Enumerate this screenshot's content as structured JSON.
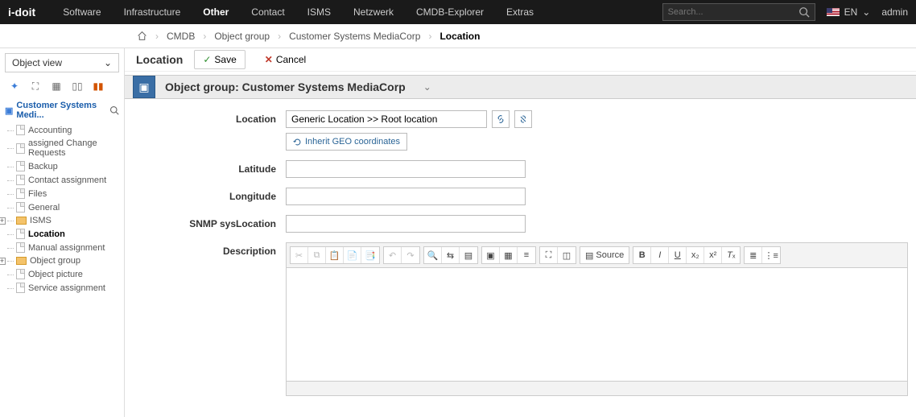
{
  "topnav": {
    "logo": "i-doit",
    "items": [
      "Software",
      "Infrastructure",
      "Other",
      "Contact",
      "ISMS",
      "Netzwerk",
      "CMDB-Explorer",
      "Extras"
    ],
    "active_index": 2,
    "search_placeholder": "Search...",
    "language": "EN",
    "username": "admin"
  },
  "breadcrumb": {
    "items": [
      "CMDB",
      "Object group",
      "Customer Systems MediaCorp",
      "Location"
    ],
    "active_index": 3
  },
  "sidebar": {
    "selector_label": "Object view",
    "root_label": "Customer Systems Medi...",
    "items": [
      {
        "label": "Accounting",
        "type": "file"
      },
      {
        "label": "assigned Change Requests",
        "type": "file"
      },
      {
        "label": "Backup",
        "type": "file"
      },
      {
        "label": "Contact assignment",
        "type": "file"
      },
      {
        "label": "Files",
        "type": "file"
      },
      {
        "label": "General",
        "type": "file"
      },
      {
        "label": "ISMS",
        "type": "folder",
        "expandable": true
      },
      {
        "label": "Location",
        "type": "file",
        "selected": true
      },
      {
        "label": "Manual assignment",
        "type": "file"
      },
      {
        "label": "Object group",
        "type": "folder",
        "expandable": true
      },
      {
        "label": "Object picture",
        "type": "file"
      },
      {
        "label": "Service assignment",
        "type": "file"
      }
    ]
  },
  "page": {
    "title": "Location",
    "save_label": "Save",
    "cancel_label": "Cancel",
    "group_header": "Object group: Customer Systems MediaCorp"
  },
  "form": {
    "location_label": "Location",
    "location_value": "Generic Location >> Root location",
    "inherit_label": "Inherit GEO coordinates",
    "latitude_label": "Latitude",
    "latitude_value": "",
    "longitude_label": "Longitude",
    "longitude_value": "",
    "snmp_label": "SNMP sysLocation",
    "snmp_value": "",
    "description_label": "Description"
  },
  "editor": {
    "source_label": "Source"
  }
}
